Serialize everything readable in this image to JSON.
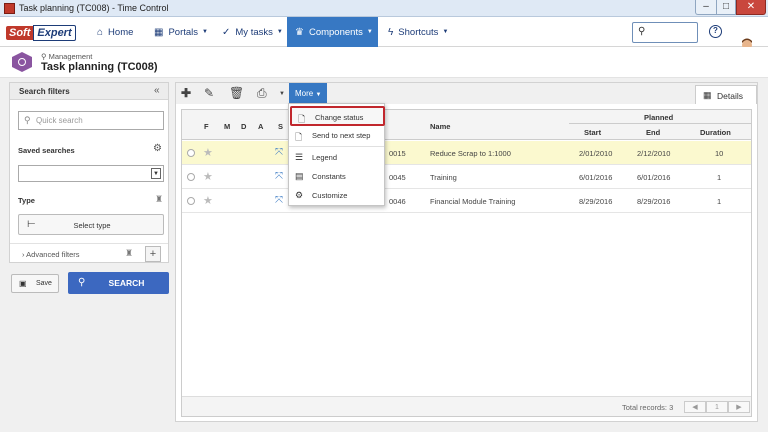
{
  "window": {
    "title": "Task planning (TC008) - Time Control",
    "min": "–",
    "max": "□",
    "close": "✕"
  },
  "logo": {
    "soft": "Soft",
    "expert": "Expert"
  },
  "nav": [
    {
      "label": "Home",
      "icon": "home-icon"
    },
    {
      "label": "Portals",
      "icon": "portals-icon"
    },
    {
      "label": "My tasks",
      "icon": "check-icon"
    },
    {
      "label": "Components",
      "icon": "trophy-icon"
    },
    {
      "label": "Shortcuts",
      "icon": "bolt-icon"
    }
  ],
  "header": {
    "breadcrumb": "Management",
    "title": "Task planning (TC008)"
  },
  "filters": {
    "title": "Search filters",
    "quick_search_placeholder": "Quick search",
    "saved_searches": "Saved searches",
    "type": "Type",
    "select_type": "Select type",
    "advanced": "Advanced filters",
    "save": "Save",
    "search": "SEARCH"
  },
  "toolbar": {
    "more": "More",
    "details": "Details"
  },
  "grid": {
    "columns": {
      "f": "F",
      "m": "M",
      "d": "D",
      "a": "A",
      "s": "S",
      "name": "Name",
      "planned": "Planned",
      "start": "Start",
      "end": "End",
      "duration": "Duration"
    },
    "rows": [
      {
        "id": "0015",
        "name": "Reduce Scrap to 1:1000",
        "start": "2/01/2010",
        "end": "2/12/2010",
        "duration": "10"
      },
      {
        "id": "0045",
        "name": "Training",
        "start": "6/01/2016",
        "end": "6/01/2016",
        "duration": "1"
      },
      {
        "id": "0046",
        "name": "Financial Module Training",
        "start": "8/29/2016",
        "end": "8/29/2016",
        "duration": "1"
      }
    ],
    "total_records": "Total records: 3",
    "page": "1"
  },
  "menu": [
    {
      "label": "Change status",
      "icon": "change-status-icon"
    },
    {
      "label": "Send to next step",
      "icon": "send-next-icon"
    },
    {
      "label": "Legend",
      "icon": "legend-icon"
    },
    {
      "label": "Constants",
      "icon": "constants-icon"
    },
    {
      "label": "Customize",
      "icon": "gear-icon"
    }
  ],
  "colors": {
    "accent": "#3778c3",
    "selected_row": "#fbf9cf",
    "highlight_border": "#c1272d"
  }
}
